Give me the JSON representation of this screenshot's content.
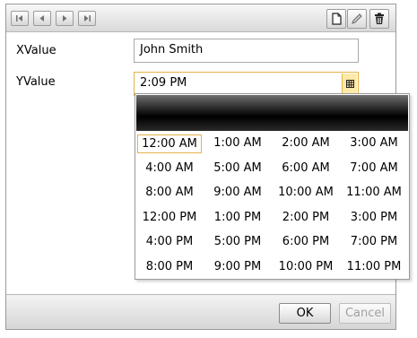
{
  "form": {
    "xvalue_label": "XValue",
    "xvalue_value": "John Smith",
    "yvalue_label": "YValue",
    "yvalue_value": "2:09 PM"
  },
  "toolbar": {
    "icons": [
      "first-record-icon",
      "previous-record-icon",
      "next-record-icon",
      "last-record-icon",
      "new-record-icon",
      "edit-icon",
      "delete-icon"
    ]
  },
  "time_picker": {
    "selected": "12:00 AM",
    "options": [
      "12:00 AM",
      "1:00 AM",
      "2:00 AM",
      "3:00 AM",
      "4:00 AM",
      "5:00 AM",
      "6:00 AM",
      "7:00 AM",
      "8:00 AM",
      "9:00 AM",
      "10:00 AM",
      "11:00 AM",
      "12:00 PM",
      "1:00 PM",
      "2:00 PM",
      "3:00 PM",
      "4:00 PM",
      "5:00 PM",
      "6:00 PM",
      "7:00 PM",
      "8:00 PM",
      "9:00 PM",
      "10:00 PM",
      "11:00 PM"
    ]
  },
  "footer": {
    "ok_label": "OK",
    "cancel_label": "Cancel"
  },
  "colors": {
    "focus_border": "#e3b348",
    "picker_button": "#fde9a8",
    "popup_header": "#000000"
  }
}
